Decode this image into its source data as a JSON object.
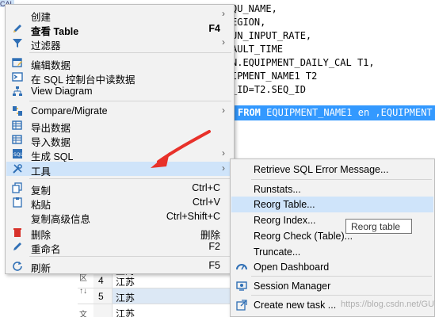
{
  "editor": {
    "corner_text": "CAL",
    "lines": [
      "QU_NAME,",
      "EGION,",
      "UN_INPUT_RATE,",
      "AULT_TIME",
      "N.EQUIPMENT_DAILY_CAL T1,",
      "IPMENT_NAME1 T2",
      "_ID=T2.SEQ_ID"
    ],
    "selected_keyword": "FROM",
    "selected_rest": "EQUIPMENT_NAME1 en ,EQUIPMENT"
  },
  "grid": {
    "rows": [
      {
        "idx": "",
        "value": "上海"
      },
      {
        "idx": "4",
        "value": "江苏"
      },
      {
        "idx": "5",
        "value": "江苏"
      },
      {
        "idx": "",
        "value": "江苏"
      }
    ],
    "side_glyphs": [
      "区",
      "↑↓",
      "文"
    ]
  },
  "menu": {
    "items": [
      {
        "label": "创建",
        "shortcut": "",
        "submenu": true,
        "icon": "blank"
      },
      {
        "label": "查看 Table",
        "shortcut": "F4",
        "submenu": false,
        "icon": "pencil-icon",
        "bold": true
      },
      {
        "label": "过滤器",
        "shortcut": "",
        "submenu": true,
        "icon": "filter-icon"
      },
      {
        "label": "编辑数据",
        "shortcut": "",
        "submenu": false,
        "icon": "edit-data-icon"
      },
      {
        "label": "在 SQL 控制台中读数据",
        "shortcut": "",
        "submenu": false,
        "icon": "sql-console-icon"
      },
      {
        "label": "View Diagram",
        "shortcut": "",
        "submenu": false,
        "icon": "diagram-icon"
      },
      {
        "label": "Compare/Migrate",
        "shortcut": "",
        "submenu": true,
        "icon": "compare-icon"
      },
      {
        "label": "导出数据",
        "shortcut": "",
        "submenu": false,
        "icon": "export-icon"
      },
      {
        "label": "导入数据",
        "shortcut": "",
        "submenu": false,
        "icon": "import-icon"
      },
      {
        "label": "生成 SQL",
        "shortcut": "",
        "submenu": true,
        "icon": "generate-sql-icon"
      },
      {
        "label": "工具",
        "shortcut": "",
        "submenu": true,
        "icon": "tools-icon"
      },
      {
        "label": "复制",
        "shortcut": "Ctrl+C",
        "submenu": false,
        "icon": "copy-icon"
      },
      {
        "label": "粘贴",
        "shortcut": "Ctrl+V",
        "submenu": false,
        "icon": "paste-icon"
      },
      {
        "label": "复制高级信息",
        "shortcut": "Ctrl+Shift+C",
        "submenu": false,
        "icon": "blank"
      },
      {
        "label": "删除",
        "shortcut": "删除",
        "submenu": false,
        "icon": "delete-icon"
      },
      {
        "label": "重命名",
        "shortcut": "F2",
        "submenu": false,
        "icon": "rename-icon"
      },
      {
        "label": "刷新",
        "shortcut": "F5",
        "submenu": false,
        "icon": "refresh-icon"
      }
    ]
  },
  "submenu": {
    "items": [
      {
        "label": "Retrieve SQL Error Message...",
        "icon": ""
      },
      {
        "label": "Runstats...",
        "icon": ""
      },
      {
        "label": "Reorg Table...",
        "icon": ""
      },
      {
        "label": "Reorg Index...",
        "icon": ""
      },
      {
        "label": "Reorg Check (Table)...",
        "icon": ""
      },
      {
        "label": "Truncate...",
        "icon": ""
      },
      {
        "label": "Open Dashboard",
        "icon": "dashboard-icon"
      },
      {
        "label": "Session Manager",
        "icon": "session-manager-icon"
      },
      {
        "label": "Create new task ...",
        "icon": "task-icon"
      }
    ]
  },
  "tooltip": {
    "text": "Reorg table"
  },
  "watermark": {
    "text": "https://blog.csdn.net/GUYyyy"
  },
  "colors": {
    "highlight": "#cfe4fa",
    "selection": "#3399ff",
    "arrow": "#e8312a"
  }
}
